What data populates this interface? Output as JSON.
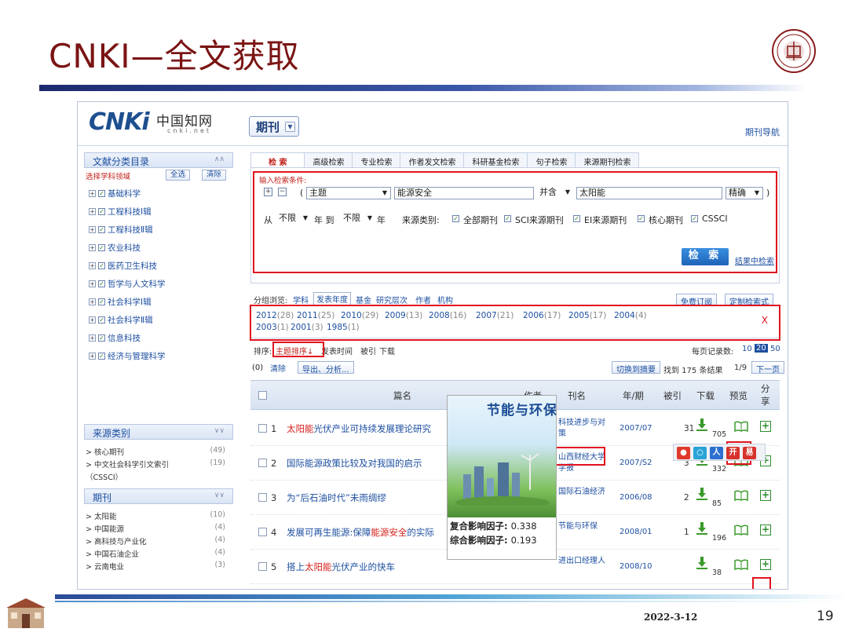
{
  "slide": {
    "title": "CNKI—全文获取",
    "date": "2022-3-12",
    "page": "19"
  },
  "header": {
    "logo_text": "CNKi",
    "logo_cn": "中国知网",
    "logo_domain": "cnki.net",
    "db_select": "期刊",
    "journal_nav": "期刊导航"
  },
  "sidebar": {
    "category_title": "文献分类目录",
    "field_label": "选择学科领域",
    "select_all": "全选",
    "clear": "清除",
    "categories": [
      "基础科学",
      "工程科技Ⅰ辑",
      "工程科技Ⅱ辑",
      "农业科技",
      "医药卫生科技",
      "哲学与人文科学",
      "社会科学Ⅰ辑",
      "社会科学Ⅱ辑",
      "信息科技",
      "经济与管理科学"
    ],
    "source_title": "来源类别",
    "sources": [
      {
        "label": "> 核心期刊",
        "count": "(49)"
      },
      {
        "label": "> 中文社会科学引文索引",
        "count": "(19)"
      },
      {
        "label": "（CSSCI）",
        "count": ""
      }
    ],
    "journal_title": "期刊",
    "journals": [
      {
        "label": "> 太阳能",
        "count": "(10)"
      },
      {
        "label": "> 中国能源",
        "count": "(4)"
      },
      {
        "label": "> 高科技与产业化",
        "count": "(4)"
      },
      {
        "label": "> 中国石油企业",
        "count": "(4)"
      },
      {
        "label": "> 云南电业",
        "count": "(3)"
      }
    ]
  },
  "tabs": [
    "检 索",
    "高级检索",
    "专业检索",
    "作者发文检索",
    "科研基金检索",
    "句子检索",
    "来源期刊检索"
  ],
  "search": {
    "cond_label": "输入检索条件:",
    "paren_open": "(",
    "field1": "主题",
    "value1": "能源安全",
    "op": "并含",
    "value2": "太阳能",
    "match": "精确",
    "paren_close": ")",
    "from_label": "从",
    "from_val": "不限",
    "year_label1": "年 到",
    "to_val": "不限",
    "year_label2": "年",
    "source_label": "来源类别:",
    "opt_all": "全部期刊",
    "opt_sci": "SCI来源期刊",
    "opt_ei": "EI来源期刊",
    "opt_core": "核心期刊",
    "opt_cssci": "CSSCI",
    "search_btn": "检 索",
    "within_link": "结果中检索"
  },
  "group": {
    "label": "分组浏览:",
    "items": [
      "学科",
      "发表年度",
      "基金",
      "研究层次",
      "作者",
      "机构"
    ],
    "free_sub": "免费订阅",
    "custom": "定制检索式"
  },
  "years": [
    {
      "y": "2012",
      "c": "(28)"
    },
    {
      "y": "2011",
      "c": "(25)"
    },
    {
      "y": "2010",
      "c": "(29)"
    },
    {
      "y": "2009",
      "c": "(13)"
    },
    {
      "y": "2008",
      "c": "(16)"
    },
    {
      "y": "2007",
      "c": "(21)"
    },
    {
      "y": "2006",
      "c": "(17)"
    },
    {
      "y": "2005",
      "c": "(17)"
    },
    {
      "y": "2004",
      "c": "(4)"
    },
    {
      "y": "2003",
      "c": "(1)"
    },
    {
      "y": "2001",
      "c": "(3)"
    },
    {
      "y": "1985",
      "c": "(1)"
    }
  ],
  "years_close": "X",
  "sort": {
    "label": "排序:",
    "items": [
      "主题排序↓",
      "发表时间",
      "被引",
      "下载"
    ],
    "per_page_label": "每页记录数:",
    "per_page_opts": [
      "10",
      "20",
      "50"
    ]
  },
  "actions": {
    "selected": "(0)",
    "clear": "清除",
    "export": "导出、分析...",
    "switch": "切换到摘要",
    "found": "找到 175 条结果",
    "pages": "1/9",
    "next": "下一页"
  },
  "table": {
    "headers": [
      "篇名",
      "作者",
      "刊名",
      "年/期",
      "被引",
      "下载",
      "预览",
      "分享"
    ],
    "rows": [
      {
        "n": "1",
        "pre": "",
        "hl": "太阳能",
        "post": "光伏产业可持续发展理论研究",
        "journal": "科技进步与对策",
        "year": "2007/07",
        "cite": "31",
        "dl": "705"
      },
      {
        "n": "2",
        "pre": "国际能源政策比较及对我国的启示",
        "hl": "",
        "post": "",
        "journal": "山西财经大学学报",
        "year": "2007/S2",
        "cite": "3",
        "dl": "332"
      },
      {
        "n": "3",
        "pre": "为“后石油时代”未雨绸缪",
        "hl": "",
        "post": "",
        "journal": "国际石油经济",
        "year": "2006/08",
        "cite": "2",
        "dl": "85"
      },
      {
        "n": "4",
        "pre": "发展可再生能源:保障",
        "hl": "能源安全",
        "post": "的实际",
        "journal": "节能与环保",
        "year": "2008/01",
        "cite": "1",
        "dl": "196"
      },
      {
        "n": "5",
        "pre": "搭上",
        "hl": "太阳能",
        "post": "光伏产业的快车",
        "journal": "进出口经理人",
        "year": "2008/10",
        "cite": "",
        "dl": "38"
      }
    ]
  },
  "cover": {
    "name": "节能与环保",
    "factor1_label": "复合影响因子:",
    "factor1": "0.338",
    "factor2_label": "综合影响因子:",
    "factor2": "0.193"
  },
  "colors": {
    "title": "#7a1414",
    "highlight_box": "#e1131f",
    "link": "#1d4fa0"
  }
}
